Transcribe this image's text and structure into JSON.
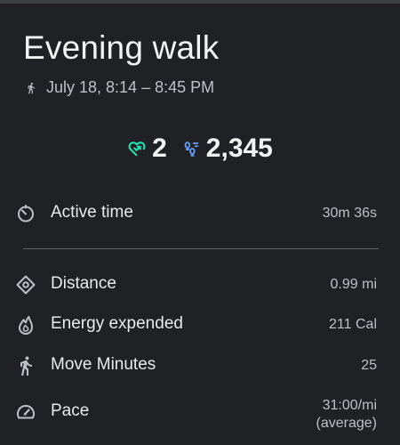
{
  "activity": {
    "title": "Evening walk",
    "time_range": "July 18, 8:14 – 8:45 PM"
  },
  "summary": {
    "heart_points": "2",
    "steps": "2,345"
  },
  "metrics": {
    "active_time": {
      "label": "Active time",
      "value": "30m 36s"
    },
    "distance": {
      "label": "Distance",
      "value": "0.99 mi"
    },
    "energy": {
      "label": "Energy expended",
      "value": "211 Cal"
    },
    "move_minutes": {
      "label": "Move Minutes",
      "value": "25"
    },
    "pace": {
      "label": "Pace",
      "value": "31:00/mi",
      "qualifier": "(average)"
    }
  },
  "colors": {
    "background": "#202124",
    "heart_points_accent": "#1de9b6",
    "steps_accent": "#669df6",
    "text_primary": "#e8eaed",
    "text_secondary": "#bdc1c6"
  },
  "icons": {
    "walk": "walk-icon",
    "heart_points": "heart-points-icon",
    "steps": "steps-icon",
    "active_time": "timer-icon",
    "distance": "location-diamond-icon",
    "energy": "flame-icon",
    "move_minutes": "walk-icon",
    "pace": "speedometer-icon"
  }
}
